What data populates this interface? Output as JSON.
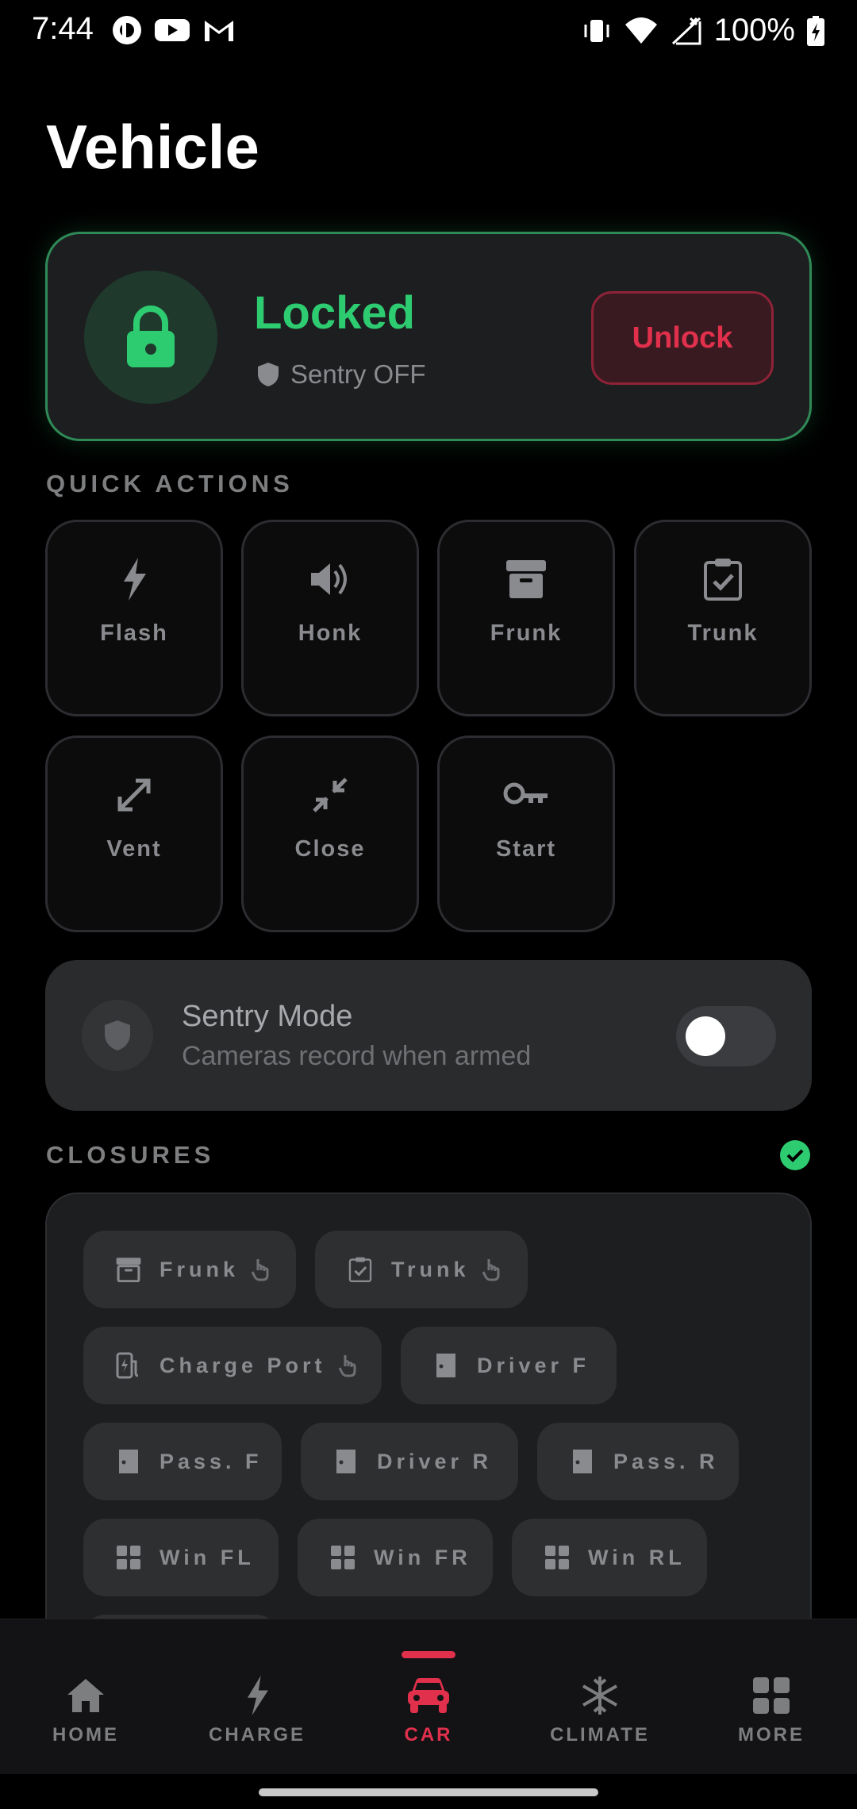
{
  "status_bar": {
    "time": "7:44",
    "battery_pct": "100%"
  },
  "page": {
    "title": "Vehicle"
  },
  "lock_card": {
    "status": "Locked",
    "sentry_status": "Sentry OFF",
    "unlock_label": "Unlock"
  },
  "quick_actions": {
    "label": "QUICK ACTIONS",
    "items": [
      {
        "label": "Flash",
        "icon": "bolt-icon"
      },
      {
        "label": "Honk",
        "icon": "speaker-icon"
      },
      {
        "label": "Frunk",
        "icon": "archive-icon"
      },
      {
        "label": "Trunk",
        "icon": "clipboard-check-icon"
      },
      {
        "label": "Vent",
        "icon": "expand-icon"
      },
      {
        "label": "Close",
        "icon": "collapse-icon"
      },
      {
        "label": "Start",
        "icon": "key-icon"
      }
    ]
  },
  "sentry_mode": {
    "title": "Sentry Mode",
    "subtitle": "Cameras record when armed",
    "enabled": false
  },
  "closures": {
    "label": "CLOSURES",
    "all_closed": true,
    "chips": [
      {
        "label": "Frunk",
        "icon": "archive-icon"
      },
      {
        "label": "Trunk",
        "icon": "clipboard-check-icon"
      },
      {
        "label": "Charge Port",
        "icon": "charge-port-icon"
      },
      {
        "label": "Driver F",
        "icon": "door-icon"
      },
      {
        "label": "Pass. F",
        "icon": "door-icon"
      },
      {
        "label": "Driver R",
        "icon": "door-icon"
      },
      {
        "label": "Pass. R",
        "icon": "door-icon"
      },
      {
        "label": "Win FL",
        "icon": "window-icon"
      },
      {
        "label": "Win FR",
        "icon": "window-icon"
      },
      {
        "label": "Win RL",
        "icon": "window-icon"
      }
    ]
  },
  "bottom_nav": {
    "items": [
      {
        "label": "HOME",
        "icon": "home-icon"
      },
      {
        "label": "CHARGE",
        "icon": "bolt-icon"
      },
      {
        "label": "CAR",
        "icon": "car-icon",
        "active": true
      },
      {
        "label": "CLIMATE",
        "icon": "snowflake-icon"
      },
      {
        "label": "MORE",
        "icon": "grid-icon"
      }
    ]
  },
  "colors": {
    "accent_red": "#e0304c",
    "locked_green": "#2ecc71",
    "card_bg": "#1d1e20"
  }
}
